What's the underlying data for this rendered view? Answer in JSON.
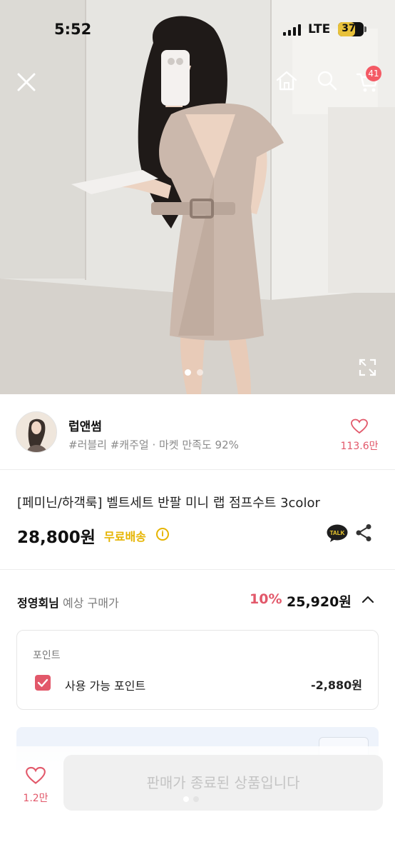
{
  "status_bar": {
    "time": "5:52",
    "network": "LTE",
    "battery": "37"
  },
  "hero": {
    "icons": [
      "close-icon",
      "home-icon",
      "search-icon",
      "cart-icon",
      "expand-icon"
    ],
    "cart_badge": "41",
    "slide_count": 2,
    "active_slide": 1
  },
  "seller": {
    "name": "럽앤썸",
    "tags": "#러블리 #캐주얼 · 마켓 만족도 92%",
    "likes": "113.6만"
  },
  "product": {
    "title": "[페미닌/하객룩] 벨트세트 반팔 미니 랩 점프수트 3color",
    "price": "28,800원",
    "shipping": "무료배송",
    "info_icon": "i"
  },
  "expected_price": {
    "member_name": "정영회님",
    "label": "예상 구매가",
    "discount_rate": "10%",
    "price": "25,920원"
  },
  "points": {
    "title": "포인트",
    "label": "사용 가능 포인트",
    "value": "-2,880원",
    "checked": true
  },
  "bottom_bar": {
    "wish_count": "1.2만",
    "soldout_label": "판매가 종료된 상품입니다"
  },
  "colors": {
    "accent": "#e2586a",
    "shipping": "#e6b400",
    "badge": "#f45a65"
  }
}
